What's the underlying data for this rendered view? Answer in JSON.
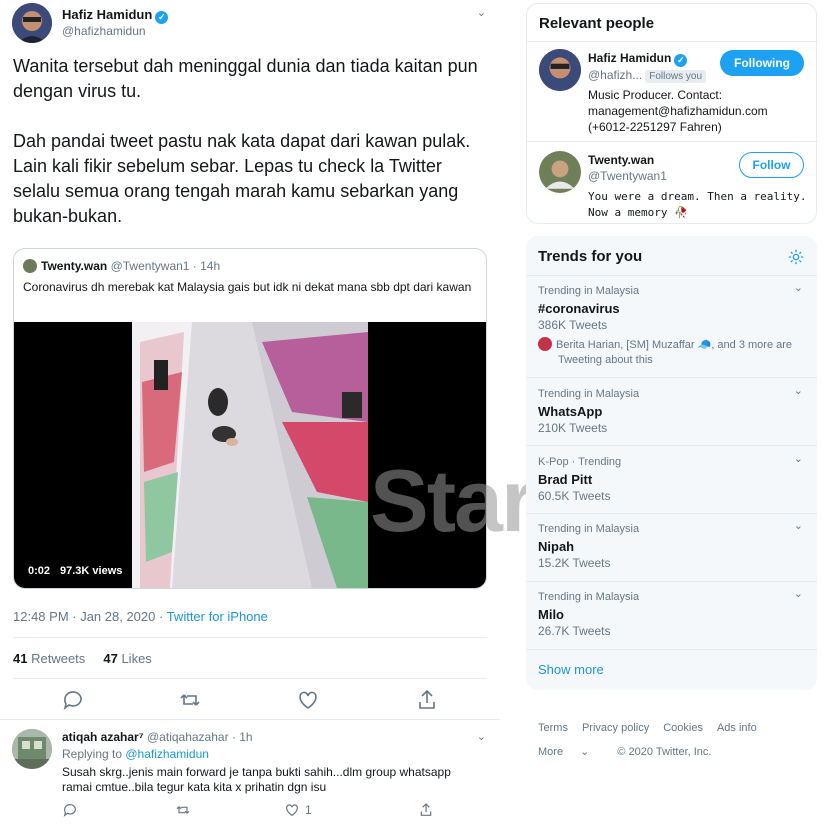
{
  "tweet": {
    "author_name": "Hafiz Hamidun",
    "author_handle": "@hafizhamidun",
    "text_p1": "Wanita tersebut dah meninggal dunia dan tiada kaitan pun dengan virus tu.",
    "text_p2": "Dah pandai tweet pastu nak kata dapat dari kawan pulak. Lain kali fikir sebelum sebar. Lepas tu check la Twitter selalu semua orang tengah marah kamu sebarkan yang bukan-bukan.",
    "timestamp": "12:48 PM · Jan 28, 2020 · ",
    "source": "Twitter for iPhone",
    "retweets": "41",
    "retweets_label": "Retweets",
    "likes": "47",
    "likes_label": "Likes"
  },
  "quoted": {
    "name": "Twenty.wan",
    "meta": "@Twentywan1 · 14h",
    "text": "Coronavirus dh merebak kat Malaysia gais but idk ni dekat mana sbb dpt dari kawan",
    "video_time": "0:02",
    "video_views": "97.3K views"
  },
  "watermark": "Star",
  "reply": {
    "name": "atiqah azahar⁷",
    "meta": "@atiqahazahar · 1h",
    "replying_to_label": "Replying to ",
    "replying_to": "@hafizhamidun",
    "text": "Susah skrg..jenis main forward je tanpa bukti sahih...dlm group whatsapp ramai cmtue..bila tegur kata kita x prihatin dgn isu",
    "reply_count": "1"
  },
  "relevant_people": {
    "title": "Relevant people",
    "people": [
      {
        "name": "Hafiz Hamidun",
        "handle": "@hafizh...",
        "follows_you": "Follows you",
        "button": "Following",
        "bio": "Music Producer. Contact: management@hafizhamidun.com (+6012-2251297 Fahren)"
      },
      {
        "name": "Twenty.wan",
        "handle": "@Twentywan1",
        "button": "Follow",
        "bio": "You were a dream. Then a reality. Now a memory 🥀"
      }
    ]
  },
  "trends": {
    "title": "Trends for you",
    "items": [
      {
        "context": "Trending in Malaysia",
        "name": "#coronavirus",
        "count": "386K Tweets",
        "extra": "Berita Harian, [SM] Muzaffar 🧢, and 3 more are",
        "extra2": "Tweeting about this"
      },
      {
        "context": "Trending in Malaysia",
        "name": "WhatsApp",
        "count": "210K Tweets"
      },
      {
        "context": "K-Pop · Trending",
        "name": "Brad Pitt",
        "count": "60.5K Tweets"
      },
      {
        "context": "Trending in Malaysia",
        "name": "Nipah",
        "count": "15.2K Tweets"
      },
      {
        "context": "Trending in Malaysia",
        "name": "Milo",
        "count": "26.7K Tweets"
      }
    ],
    "show_more": "Show more"
  },
  "footer": {
    "terms": "Terms",
    "privacy": "Privacy policy",
    "cookies": "Cookies",
    "ads": "Ads info",
    "more": "More",
    "copyright": "© 2020 Twitter, Inc."
  },
  "colors": {
    "accent": "#1da1f2",
    "link": "#1b95e0",
    "muted": "#657786"
  }
}
